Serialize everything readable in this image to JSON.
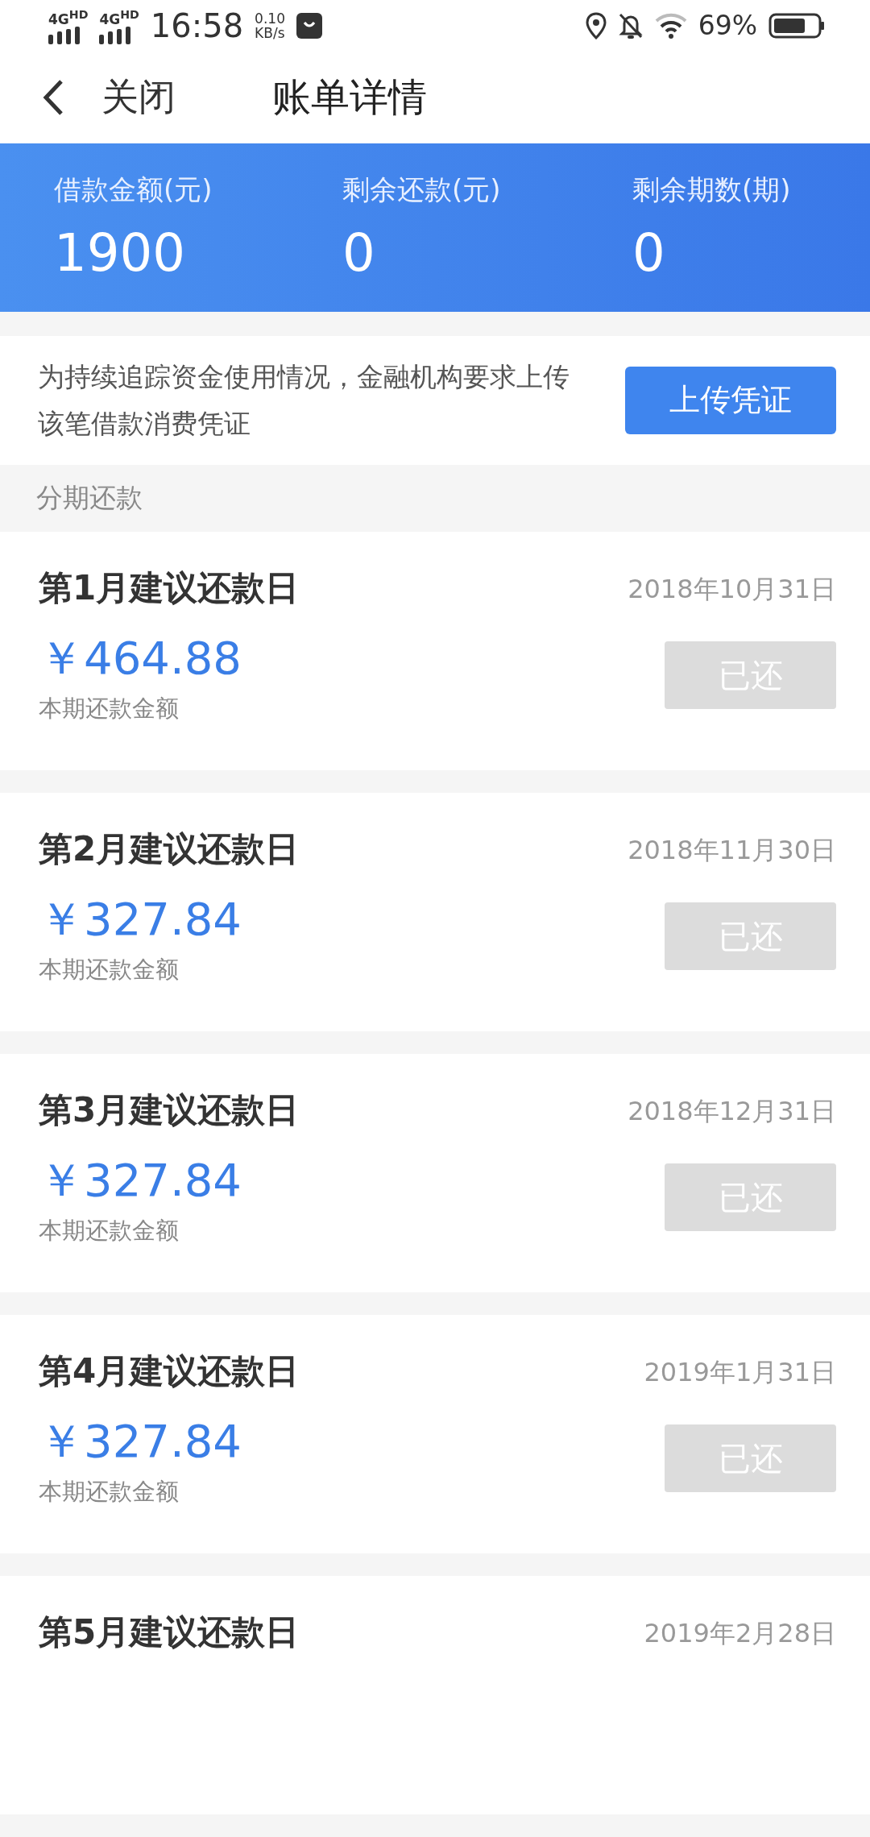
{
  "status_bar": {
    "network_1": "4G",
    "network_1_badge": "HD",
    "network_2": "4G",
    "network_2_badge": "HD",
    "time": "16:58",
    "speed_value": "0.10",
    "speed_unit": "KB/s",
    "battery": "69%"
  },
  "header": {
    "close_label": "关闭",
    "title": "账单详情"
  },
  "summary": [
    {
      "label": "借款金额(元)",
      "value": "1900"
    },
    {
      "label": "剩余还款(元)",
      "value": "0"
    },
    {
      "label": "剩余期数(期)",
      "value": "0"
    }
  ],
  "notice": {
    "text": "为持续追踪资金使用情况，金融机构要求上传该笔借款消费凭证",
    "button": "上传凭证"
  },
  "section_title": "分期还款",
  "installments": [
    {
      "title": "第1月建议还款日",
      "date": "2018年10月31日",
      "amount": "￥464.88",
      "amount_label": "本期还款金额",
      "button": "已还",
      "disabled": true
    },
    {
      "title": "第2月建议还款日",
      "date": "2018年11月30日",
      "amount": "￥327.84",
      "amount_label": "本期还款金额",
      "button": "已还",
      "disabled": true
    },
    {
      "title": "第3月建议还款日",
      "date": "2018年12月31日",
      "amount": "￥327.84",
      "amount_label": "本期还款金额",
      "button": "已还",
      "disabled": true
    },
    {
      "title": "第4月建议还款日",
      "date": "2019年1月31日",
      "amount": "￥327.84",
      "amount_label": "本期还款金额",
      "button": "已还",
      "disabled": true
    },
    {
      "title": "第5月建议还款日",
      "date": "2019年2月28日"
    }
  ]
}
